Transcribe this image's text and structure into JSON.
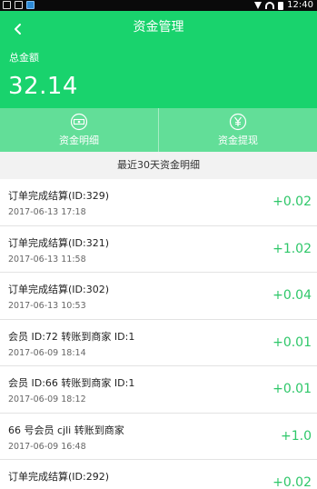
{
  "status_bar": {
    "time": "12:40"
  },
  "header": {
    "title": "资金管理",
    "total_label": "总金额",
    "total_amount": "32.14"
  },
  "actions": [
    {
      "label": "资金明细",
      "icon": "money-detail-icon"
    },
    {
      "label": "资金提现",
      "icon": "yen-withdraw-icon"
    }
  ],
  "section_title": "最近30天资金明细",
  "transactions": [
    {
      "title": "订单完成结算(ID:329)",
      "date": "2017-06-13 17:18",
      "amount": "+0.02"
    },
    {
      "title": "订单完成结算(ID:321)",
      "date": "2017-06-13 11:58",
      "amount": "+1.02"
    },
    {
      "title": "订单完成结算(ID:302)",
      "date": "2017-06-13 10:53",
      "amount": "+0.04"
    },
    {
      "title": "会员 ID:72 转账到商家 ID:1",
      "date": "2017-06-09 18:14",
      "amount": "+0.01"
    },
    {
      "title": "会员 ID:66 转账到商家 ID:1",
      "date": "2017-06-09 18:12",
      "amount": "+0.01"
    },
    {
      "title": "66 号会员 cjli 转账到商家",
      "date": "2017-06-09 16:48",
      "amount": "+1.0"
    },
    {
      "title": "订单完成结算(ID:292)",
      "date": "",
      "amount": "+0.02"
    }
  ],
  "colors": {
    "brand": "#19d36d",
    "amount": "#2ec769"
  }
}
